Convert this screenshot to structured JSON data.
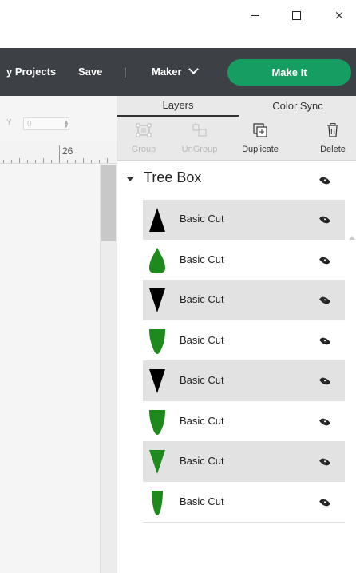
{
  "window": {
    "minimize_icon": "minimize-icon",
    "maximize_icon": "maximize-icon",
    "close_glyph": "×"
  },
  "header": {
    "projects": "y Projects",
    "save": "Save",
    "divider": "|",
    "machine": "Maker",
    "make_it": "Make It",
    "make_it_color": "#169e62"
  },
  "canvas": {
    "y_label": "Y",
    "y_value": "0",
    "ruler_label": "26"
  },
  "panel": {
    "tabs": [
      {
        "label": "Layers",
        "active": true
      },
      {
        "label": "Color Sync",
        "active": false
      }
    ],
    "tools": [
      {
        "label": "Group",
        "enabled": false,
        "icon": "group-icon"
      },
      {
        "label": "UnGroup",
        "enabled": false,
        "icon": "ungroup-icon"
      },
      {
        "label": "Duplicate",
        "enabled": true,
        "icon": "duplicate-icon"
      },
      {
        "label": "Delete",
        "enabled": true,
        "icon": "trash-icon"
      }
    ],
    "group": {
      "title": "Tree Box"
    },
    "layers": [
      {
        "name": "Basic Cut",
        "shape": "triangle-up",
        "color": "#000000",
        "shaded": true
      },
      {
        "name": "Basic Cut",
        "shape": "leaf",
        "color": "#1e8a1e",
        "shaded": false
      },
      {
        "name": "Basic Cut",
        "shape": "triangle-down",
        "color": "#000000",
        "shaded": true
      },
      {
        "name": "Basic Cut",
        "shape": "blade",
        "color": "#1e8a1e",
        "shaded": false
      },
      {
        "name": "Basic Cut",
        "shape": "triangle-down",
        "color": "#000000",
        "shaded": true
      },
      {
        "name": "Basic Cut",
        "shape": "blade",
        "color": "#1e8a1e",
        "shaded": false
      },
      {
        "name": "Basic Cut",
        "shape": "triangle-down",
        "color": "#1e8a1e",
        "shaded": true
      },
      {
        "name": "Basic Cut",
        "shape": "narrow-blade",
        "color": "#1e8a1e",
        "shaded": false
      }
    ]
  }
}
